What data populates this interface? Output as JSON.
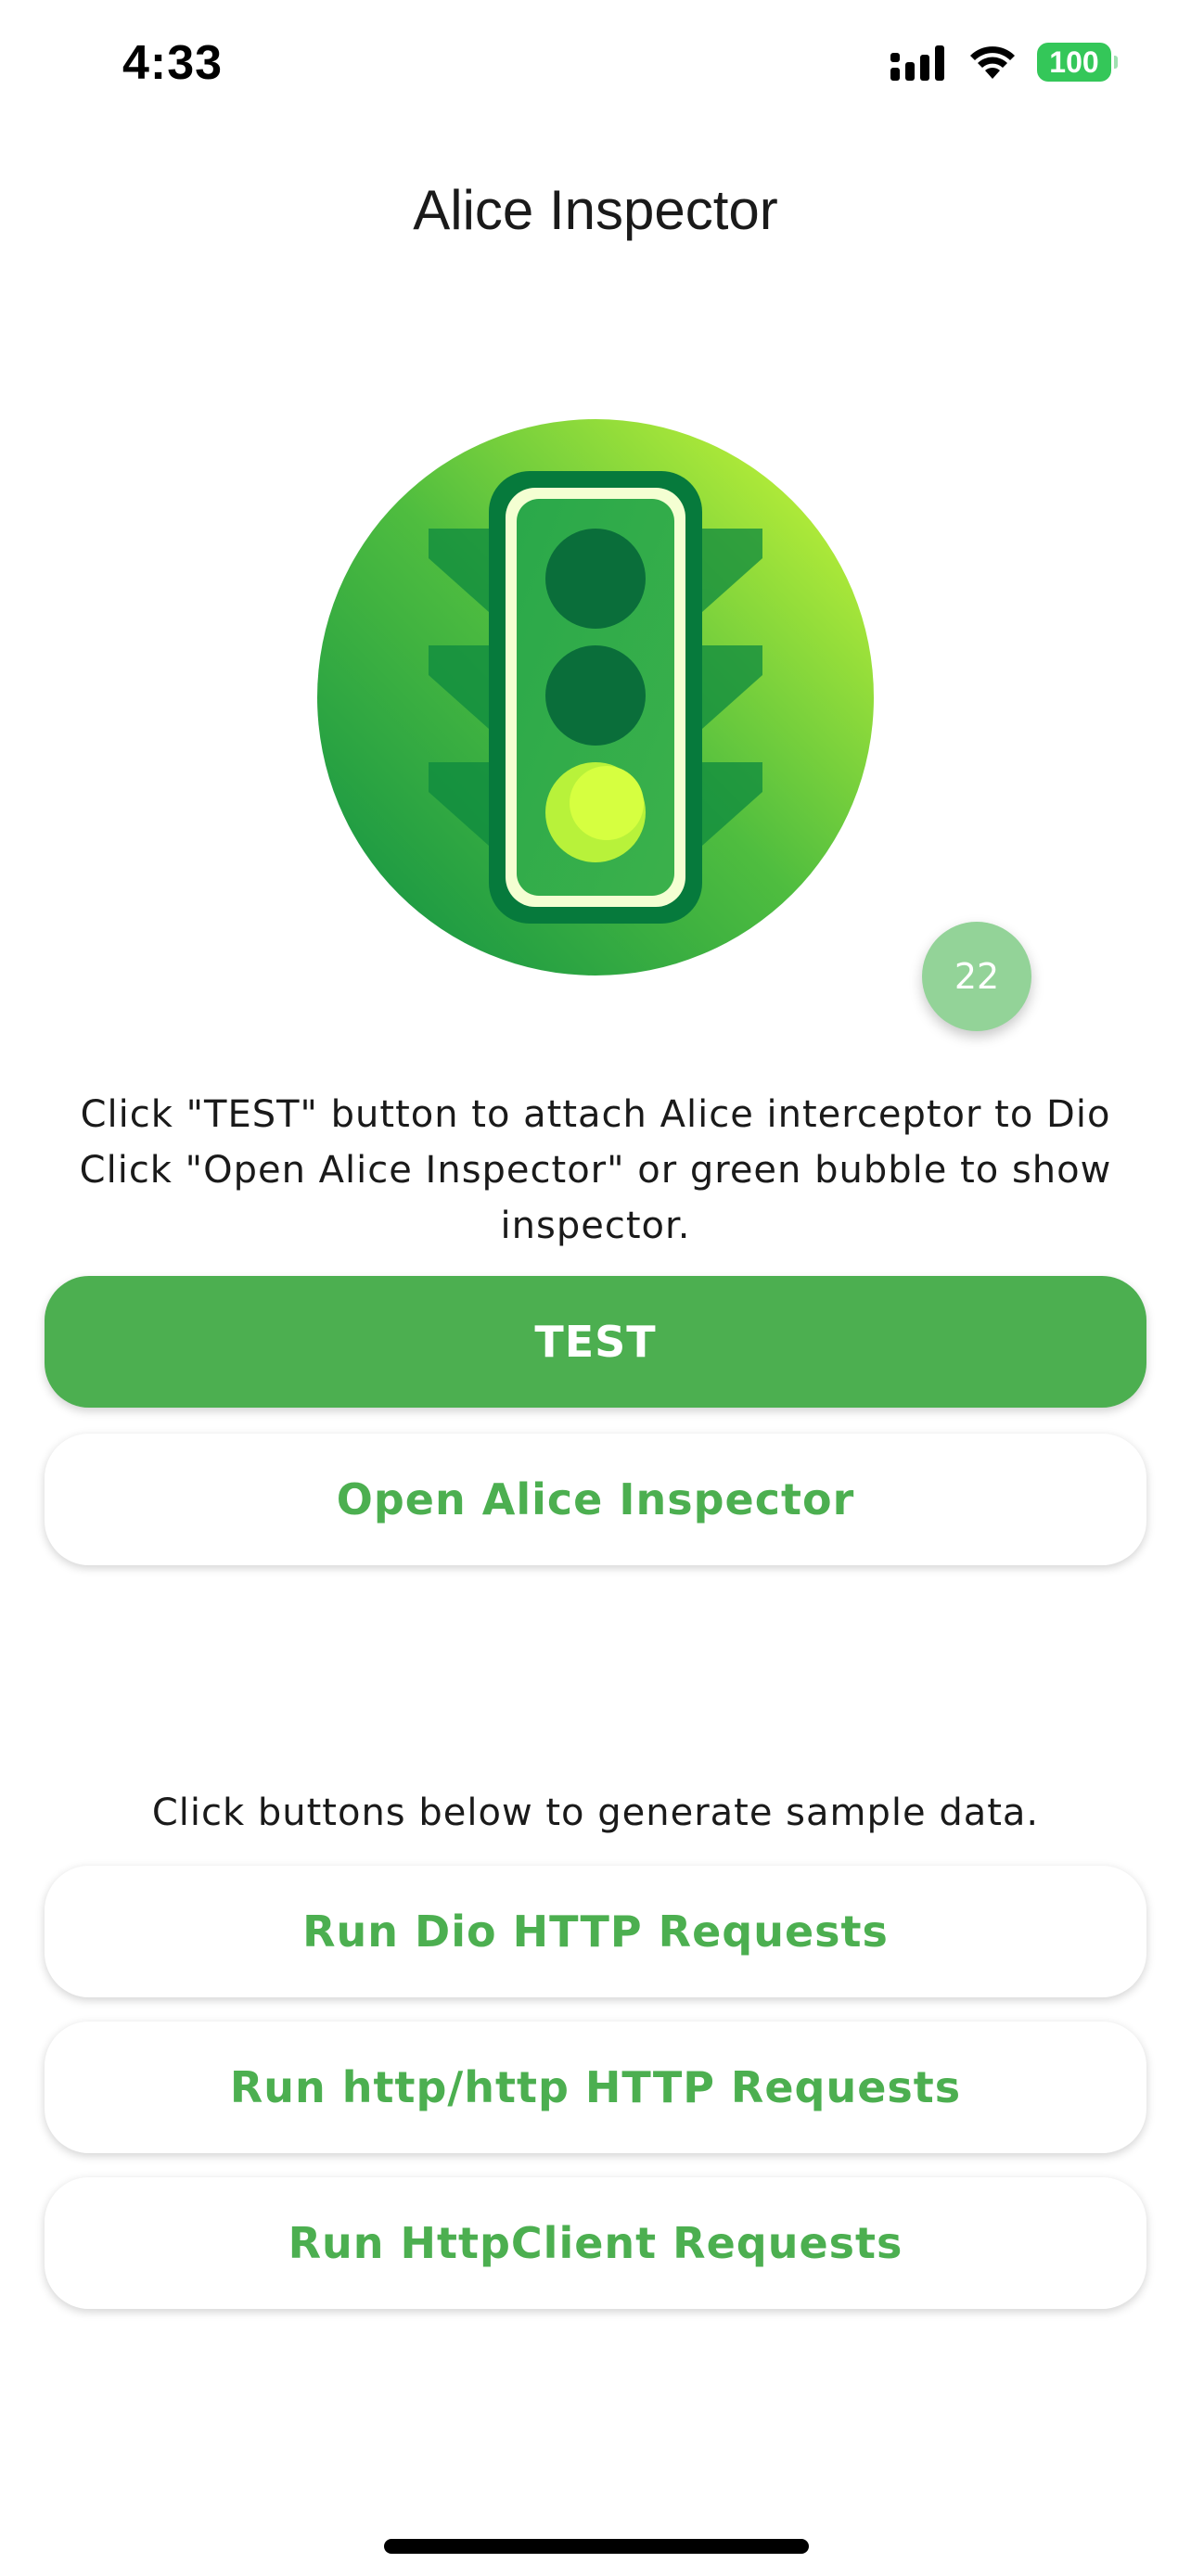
{
  "status_bar": {
    "time": "4:33",
    "battery": "100",
    "icons": [
      "cellular-signal-icon",
      "wifi-icon",
      "battery-icon"
    ]
  },
  "app": {
    "title": "Alice Inspector"
  },
  "logo": {
    "icon": "traffic-light-icon",
    "colors": {
      "gradient_start": "#0d8f45",
      "gradient_end": "#c7f23a",
      "housing": "#067a3c",
      "active_light": "#c8ff3a"
    }
  },
  "bubble": {
    "count": "22",
    "color": "#93d398"
  },
  "description": {
    "line1": "Click \"TEST\" button to attach Alice interceptor to Dio",
    "line2": "Click \"Open Alice Inspector\" or green bubble to show",
    "line3": "inspector."
  },
  "buttons": {
    "test": "TEST",
    "open_inspector": "Open Alice Inspector",
    "run_dio": "Run Dio HTTP Requests",
    "run_http": "Run http/http HTTP Requests",
    "run_httpclient": "Run HttpClient Requests"
  },
  "sample_caption": "Click buttons below to generate sample data.",
  "theme": {
    "accent": "#4caf50",
    "battery": "#34c759"
  }
}
